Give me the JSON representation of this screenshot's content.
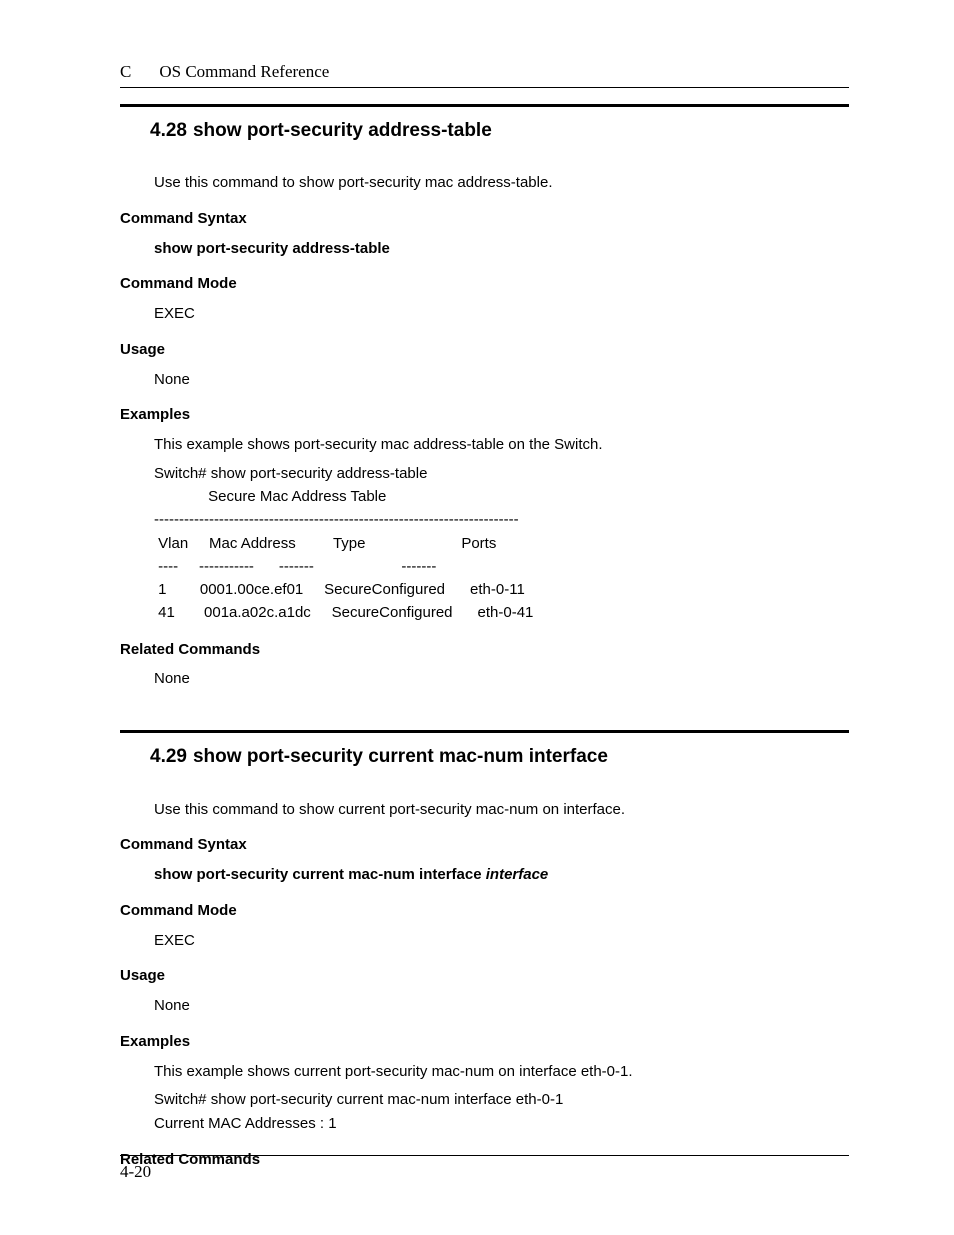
{
  "header": {
    "chapter": "C",
    "title": "OS Command Reference"
  },
  "section428": {
    "number": "4.28",
    "title": "show port-security address-table",
    "intro": "Use this command to show port-security mac address-table.",
    "syntax_label": "Command Syntax",
    "syntax": "show port-security address-table",
    "mode_label": "Command Mode",
    "mode": "EXEC",
    "usage_label": "Usage",
    "usage": "None",
    "examples_label": "Examples",
    "example_intro": "This example shows port-security mac address-table on the Switch.",
    "example_output_lines": [
      "Switch# show port-security address-table",
      "             Secure Mac Address Table",
      "-------------------------------------------------------------------------",
      " Vlan     Mac Address         Type                       Ports",
      " ----     -----------      -------                     -------",
      " 1        0001.00ce.ef01     SecureConfigured      eth-0-11",
      " 41       001a.a02c.a1dc     SecureConfigured      eth-0-41"
    ],
    "related_label": "Related Commands",
    "related": "None"
  },
  "section429": {
    "number": "4.29",
    "title": "show port-security current mac-num interface",
    "intro": "Use this command to show current port-security mac-num on interface.",
    "syntax_label": "Command Syntax",
    "syntax_fixed": "show port-security current mac-num interface ",
    "syntax_arg": "interface",
    "mode_label": "Command Mode",
    "mode": "EXEC",
    "usage_label": "Usage",
    "usage": "None",
    "examples_label": "Examples",
    "example_intro": "This example shows current port-security mac-num on interface eth-0-1.",
    "example_output_lines": [
      "Switch# show port-security current mac-num interface eth-0-1",
      "Current MAC Addresses : 1"
    ],
    "related_label": "Related Commands"
  },
  "footer": {
    "page": "4-20"
  }
}
